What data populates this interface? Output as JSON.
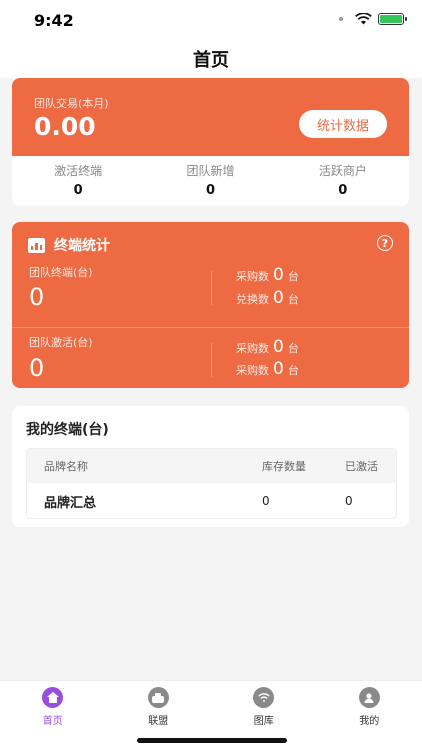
{
  "status_bar": {
    "time": "9:42"
  },
  "nav": {
    "title": "首页"
  },
  "team": {
    "label": "团队交易(本月)",
    "amount": "0.00",
    "stats_button": "统计数据",
    "stats": [
      {
        "label": "激活终端",
        "value": "0"
      },
      {
        "label": "团队新增",
        "value": "0"
      },
      {
        "label": "活跃商户",
        "value": "0"
      }
    ]
  },
  "terminal_stats": {
    "title": "终端统计",
    "help": "?",
    "rows": [
      {
        "label": "团队终端(台)",
        "value": "0",
        "pairs": [
          {
            "label": "采购数",
            "value": "0",
            "unit": "台"
          },
          {
            "label": "兑换数",
            "value": "0",
            "unit": "台"
          }
        ]
      },
      {
        "label": "团队激活(台)",
        "value": "0",
        "pairs": [
          {
            "label": "采购数",
            "value": "0",
            "unit": "台"
          },
          {
            "label": "采购数",
            "value": "0",
            "unit": "台"
          }
        ]
      }
    ]
  },
  "my_terminals": {
    "title": "我的终端(台)",
    "columns": [
      "品牌名称",
      "库存数量",
      "已激活"
    ],
    "rows": [
      [
        "品牌汇总",
        "0",
        "0"
      ]
    ]
  },
  "tabbar": {
    "items": [
      {
        "label": "首页",
        "icon": "home-icon",
        "active": true
      },
      {
        "label": "联盟",
        "icon": "alliance-icon",
        "active": false
      },
      {
        "label": "图库",
        "icon": "gallery-icon",
        "active": false
      },
      {
        "label": "我的",
        "icon": "profile-icon",
        "active": false
      }
    ]
  },
  "colors": {
    "accent": "#ee6a43",
    "tab_active": "#9b4de0"
  }
}
